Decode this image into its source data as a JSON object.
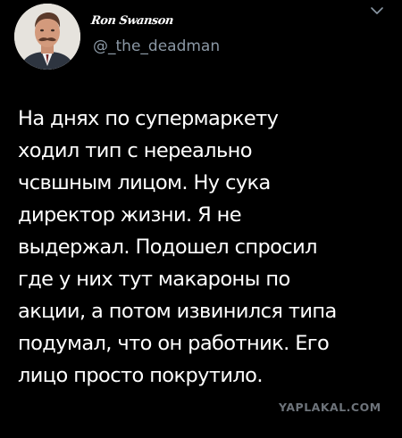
{
  "author": {
    "display_name": "Ron Swanson",
    "handle": "@_the_deadman",
    "avatar_icon": "profile-avatar"
  },
  "menu_icon": "chevron-down-icon",
  "tweet": {
    "text": "На днях по супермаркету\nходил тип с нереально\nчсвшным лицом. Ну сука\nдиректор жизни. Я не\nвыдержал. Подошел спросил\nгде у них тут макароны по\nакции, а потом извинился типа\nподумал, что он работник. Его\nлицо просто покрутило."
  },
  "watermark": "YAPLAKAL.COM",
  "colors": {
    "background": "#000000",
    "text": "#ffffff",
    "handle": "#8b98a5"
  }
}
